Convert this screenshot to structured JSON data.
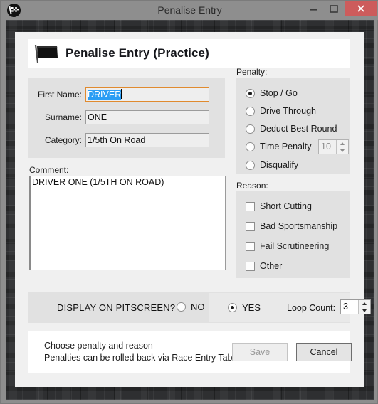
{
  "window": {
    "title": "Penalise Entry",
    "icon": "checkered-flag-icon",
    "buttons": {
      "minimize": "minimize-icon",
      "maximize": "maximize-icon",
      "close": "close-icon"
    },
    "close_color": "#cd5c5c"
  },
  "header": {
    "icon": "black-flag-icon",
    "title": "Penalise Entry (Practice)"
  },
  "details": {
    "first_name": {
      "label": "First Name:",
      "value": "DRIVER",
      "selected": true
    },
    "surname": {
      "label": "Surname:",
      "value": "ONE"
    },
    "category": {
      "label": "Category:",
      "value": "1/5th On Road"
    }
  },
  "comment": {
    "label": "Comment:",
    "value": "DRIVER ONE (1/5TH ON ROAD)"
  },
  "penalty": {
    "label": "Penalty:",
    "options": [
      {
        "label": "Stop / Go",
        "checked": true
      },
      {
        "label": "Drive Through",
        "checked": false
      },
      {
        "label": "Deduct Best Round",
        "checked": false
      },
      {
        "label": "Time Penalty",
        "checked": false
      },
      {
        "label": "Disqualify",
        "checked": false
      }
    ],
    "time_penalty_value": "10",
    "time_penalty_disabled": true
  },
  "reason": {
    "label": "Reason:",
    "options": [
      {
        "label": "Short Cutting",
        "checked": false
      },
      {
        "label": "Bad Sportsmanship",
        "checked": false
      },
      {
        "label": "Fail Scrutineering",
        "checked": false
      },
      {
        "label": "Other",
        "checked": false
      }
    ]
  },
  "pitscreen": {
    "label": "DISPLAY ON PITSCREEN?",
    "no_label": "NO",
    "no_checked": false,
    "yes_label": "YES",
    "yes_checked": true,
    "loop_count_label": "Loop Count:",
    "loop_count_value": "3"
  },
  "footer": {
    "line1": "Choose penalty and reason",
    "line2": "Penalties can be rolled back via Race Entry Tab",
    "save_label": "Save",
    "save_disabled": true,
    "cancel_label": "Cancel"
  }
}
